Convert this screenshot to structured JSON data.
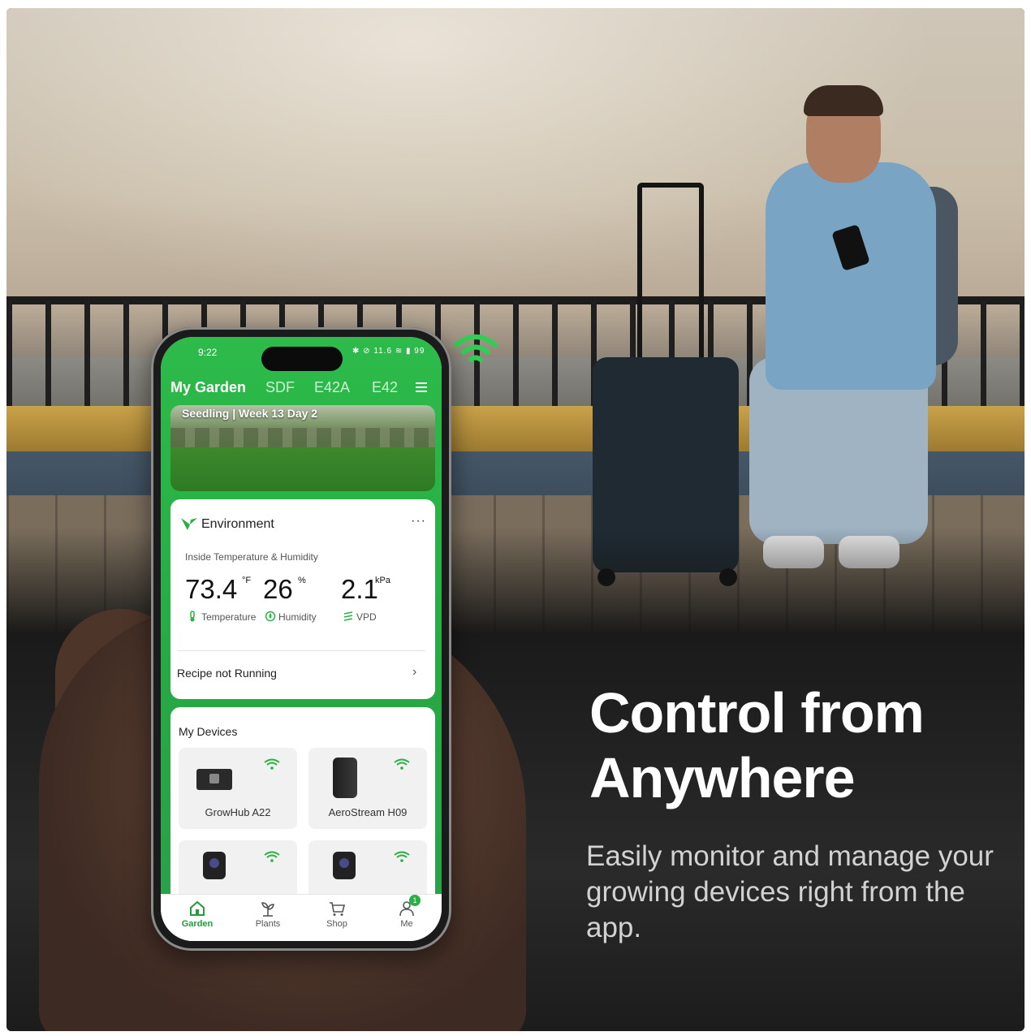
{
  "phone": {
    "status_time": "9:22",
    "status_icons": "✱ ⊘ 11.6 ≋ ▮ 99",
    "tabs": [
      "My Garden",
      "SDF",
      "E42A",
      "E42"
    ],
    "hero_label": "Seedling | Week 13 Day 2",
    "environment": {
      "title": "Environment",
      "more": "···",
      "subtitle": "Inside Temperature & Humidity",
      "temperature": {
        "value": "73.4",
        "unit": "°F",
        "label": "Temperature"
      },
      "humidity": {
        "value": "26",
        "unit": "%",
        "label": "Humidity"
      },
      "vpd": {
        "value": "2.1",
        "unit": "kPa",
        "label": "VPD"
      },
      "recipe": "Recipe not Running"
    },
    "devices": {
      "title": "My Devices",
      "items": [
        {
          "name": "GrowHub A22"
        },
        {
          "name": "AeroStream H09"
        },
        {
          "name": ""
        },
        {
          "name": ""
        }
      ]
    },
    "nav": [
      {
        "label": "Garden",
        "icon": "home-icon"
      },
      {
        "label": "Plants",
        "icon": "sprout-icon"
      },
      {
        "label": "Shop",
        "icon": "cart-icon"
      },
      {
        "label": "Me",
        "icon": "user-icon",
        "badge": "1"
      }
    ],
    "accent_color": "#27b043"
  },
  "headline": "Control from Anywhere",
  "subtext": "Easily monitor and manage your growing devices right from the app."
}
